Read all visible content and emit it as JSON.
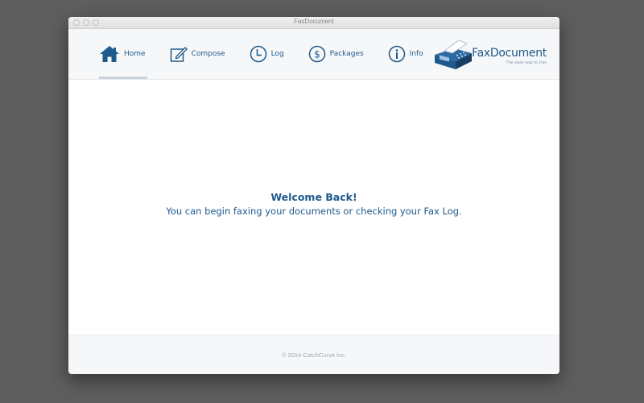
{
  "window": {
    "title": "FaxDocument"
  },
  "nav": {
    "items": [
      {
        "label": "Home",
        "icon": "home-icon"
      },
      {
        "label": "Compose",
        "icon": "compose-icon"
      },
      {
        "label": "Log",
        "icon": "clock-icon"
      },
      {
        "label": "Packages",
        "icon": "dollar-icon"
      },
      {
        "label": "Info",
        "icon": "info-icon"
      }
    ],
    "active": "Home"
  },
  "logo": {
    "name_prefix": "Fax",
    "name_suffix": "Document",
    "tagline": "The easy way to Fax"
  },
  "content": {
    "title": "Welcome Back!",
    "subtitle": "You can begin faxing your documents or checking your Fax Log."
  },
  "footer": {
    "copyright": "© 2014 CatchCurve Inc."
  },
  "colors": {
    "accent": "#1f5a8c",
    "desktop": "#5e5e5e",
    "toolbar": "#f6f7f8"
  }
}
